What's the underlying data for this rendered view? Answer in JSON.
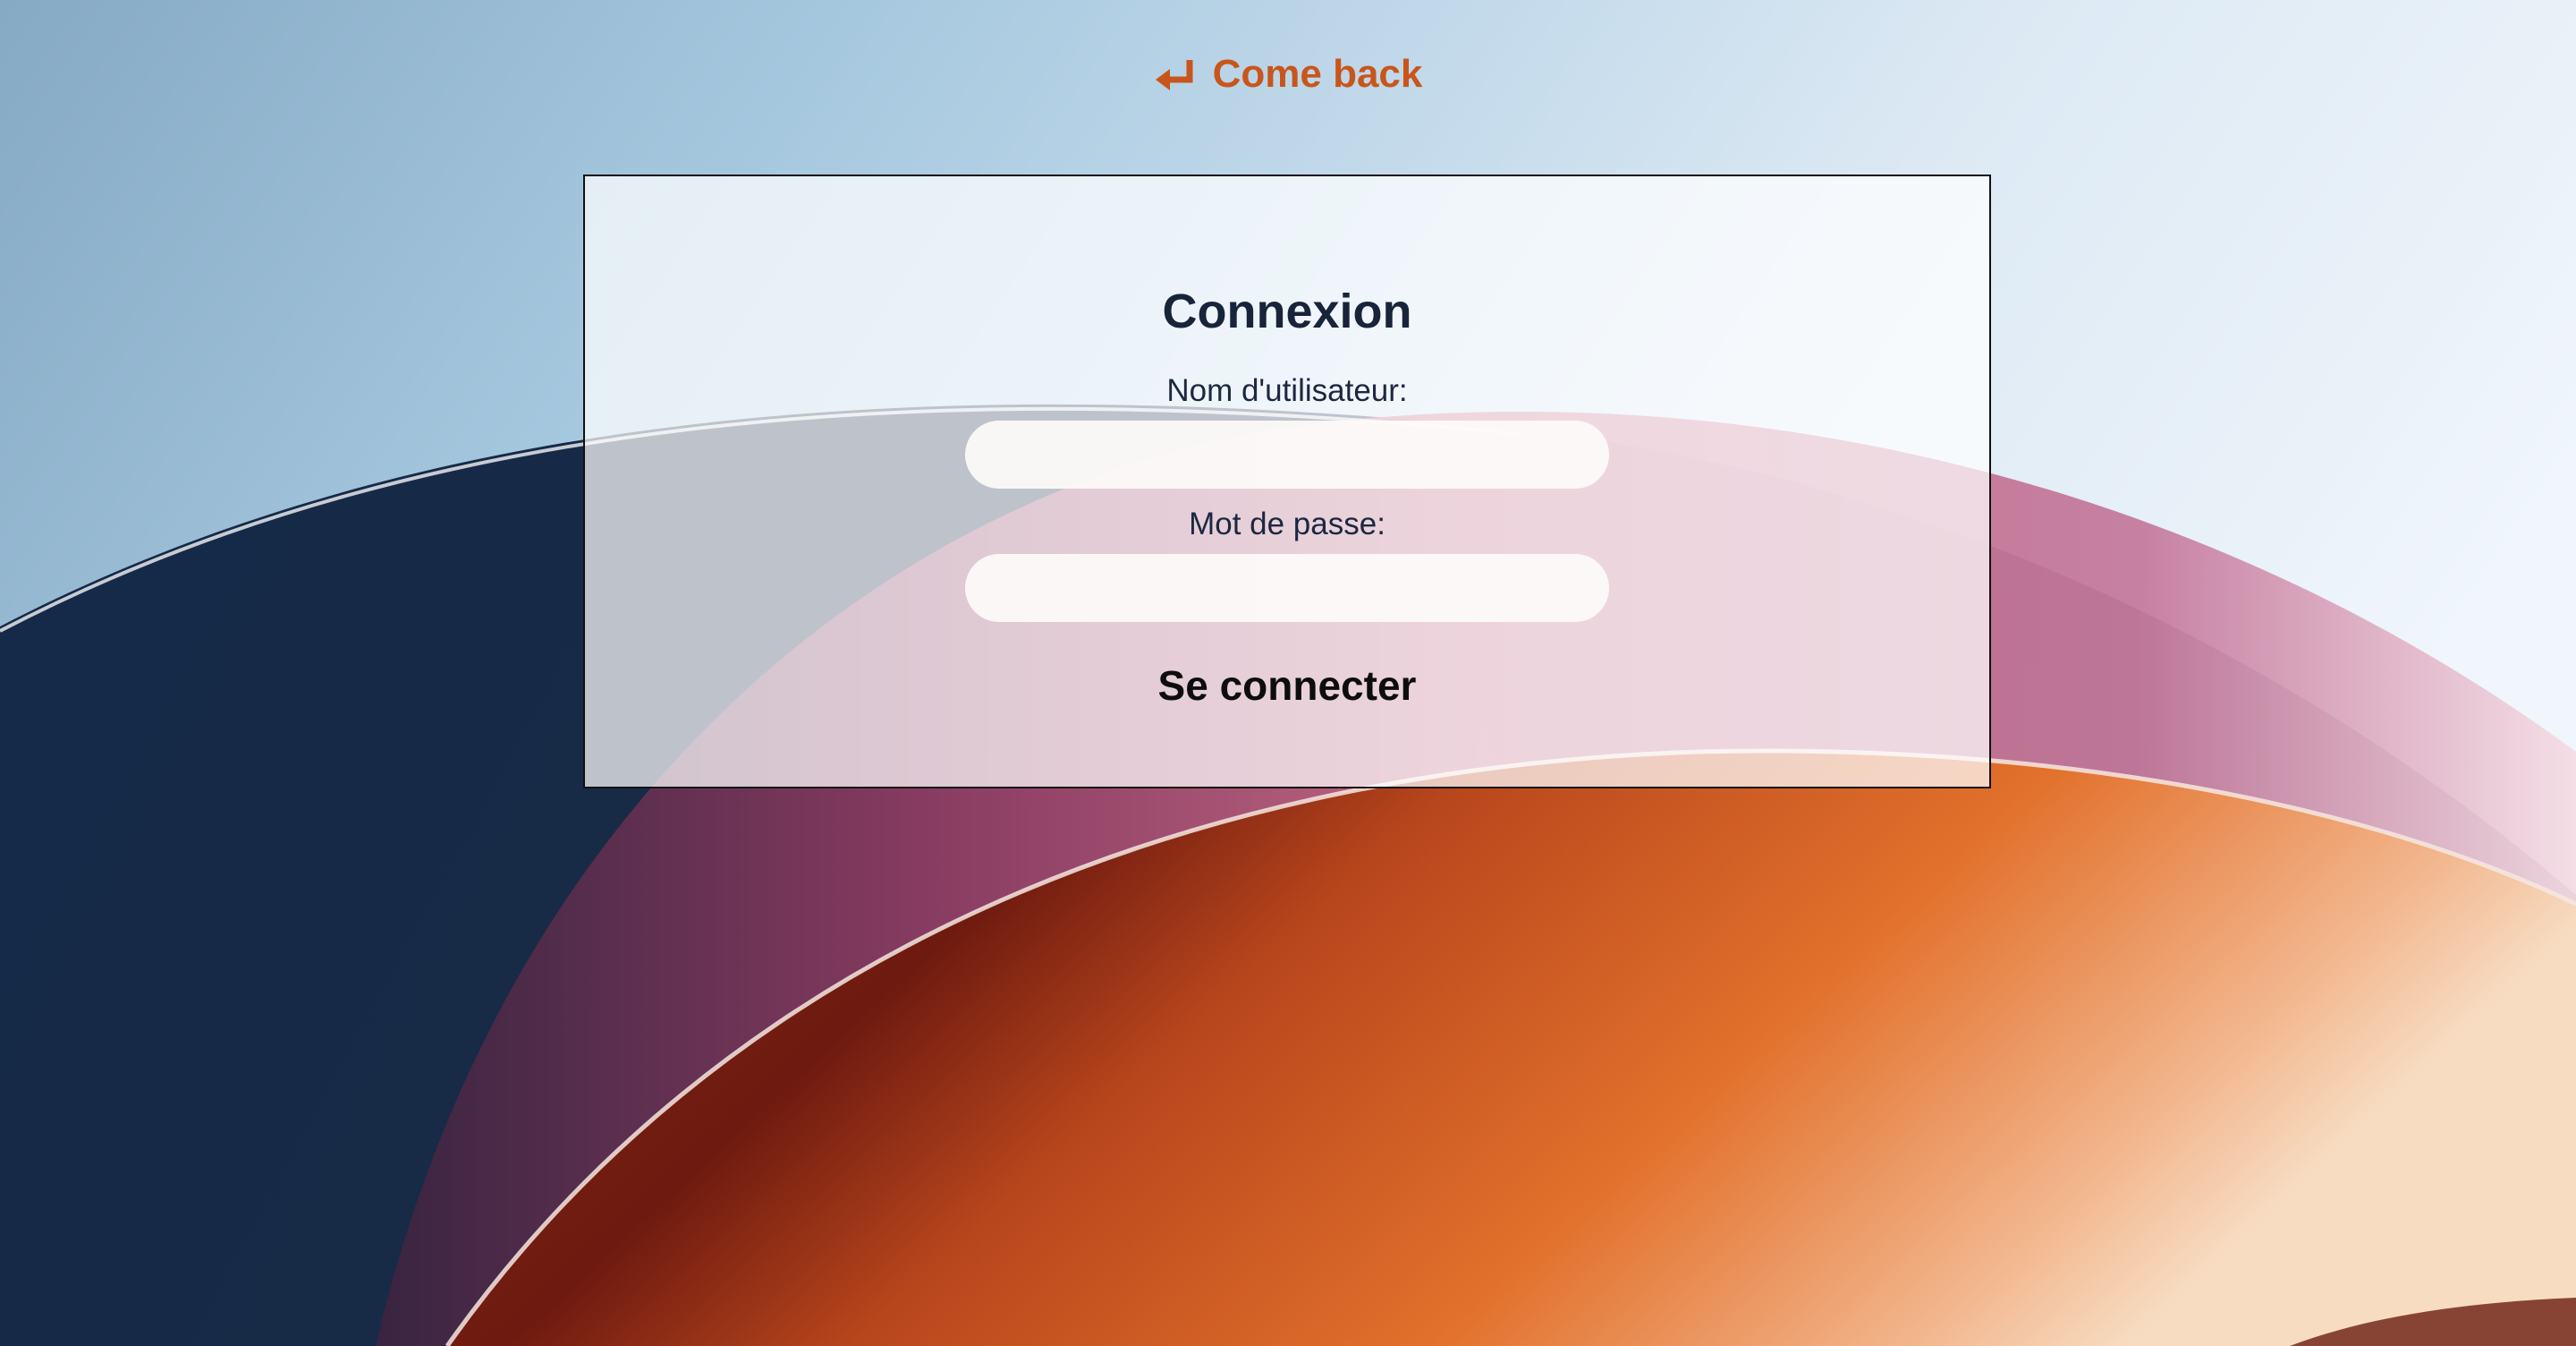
{
  "back_link": {
    "label": "Come back",
    "icon": "return-arrow-icon",
    "color": "#c8561c"
  },
  "login_form": {
    "title": "Connexion",
    "username": {
      "label": "Nom d'utilisateur:",
      "value": "",
      "placeholder": ""
    },
    "password": {
      "label": "Mot de passe:",
      "value": "",
      "placeholder": ""
    },
    "submit_label": "Se connecter"
  },
  "colors": {
    "title_text": "#17243a",
    "accent_orange": "#c8561c"
  }
}
